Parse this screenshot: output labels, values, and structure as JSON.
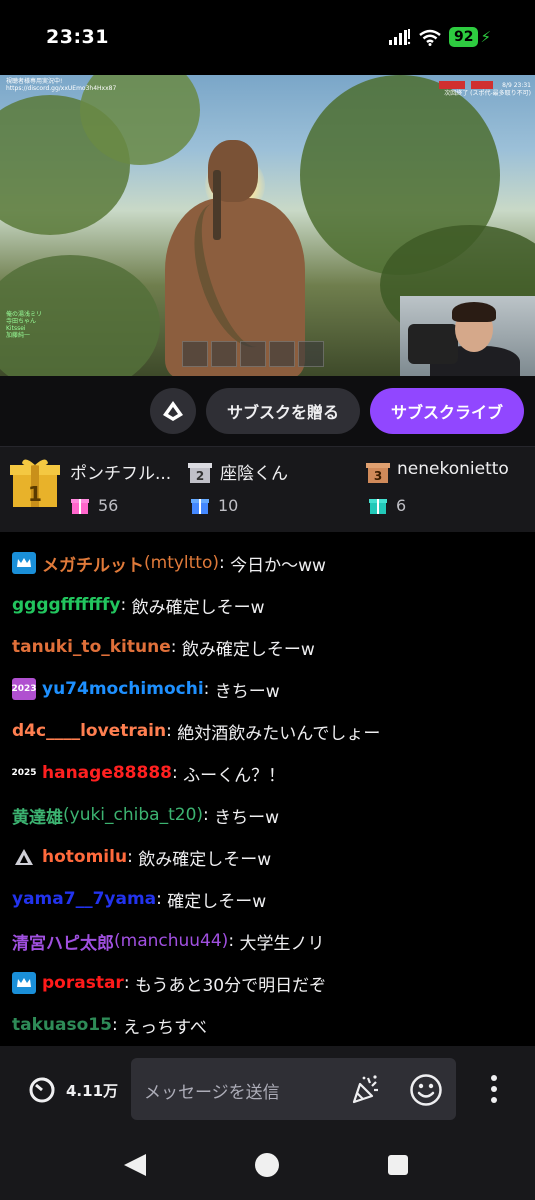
{
  "status_bar": {
    "time": "23:31",
    "battery": "92"
  },
  "video": {
    "overlay_top_left": "視聴者様専用実況中!",
    "overlay_top_left_url": "https://discord.gg/xxUEmo3h4Hxx87",
    "overlay_top_right": "8/9 23:31",
    "overlay_top_right_sub": "次回終了 (スポ代-最多取り不可)",
    "overlay_list": [
      "俺の湯浅ミリ",
      "寺田ちゃん",
      "Kitssei",
      "加藤純一"
    ]
  },
  "actions": {
    "gift_sub_label": "サブスクを贈る",
    "sub_live_label": "サブスクライブ"
  },
  "leaderboard": [
    {
      "rank": "1",
      "name": "ポンチフル...",
      "count": "56"
    },
    {
      "rank": "2",
      "name": "座陰くん",
      "count": "10"
    },
    {
      "rank": "3",
      "name": "nenekonietto",
      "count": "6"
    }
  ],
  "chat": [
    {
      "badge": "crown",
      "user": "メガチルット",
      "login": " (mtyltto)",
      "text": "今日か〜ww",
      "color": "#e07a3a"
    },
    {
      "badge": "",
      "user": "ggggfffffffy",
      "login": "",
      "text": "飲み確定しそーw",
      "color": "#22c55e"
    },
    {
      "badge": "",
      "user": "tanuki_to_kitune",
      "login": "",
      "text": "飲み確定しそーw",
      "color": "#e0703a"
    },
    {
      "badge": "2023",
      "user": "yu74mochimochi",
      "login": "",
      "text": "きちーw",
      "color": "#1e90ff"
    },
    {
      "badge": "",
      "user": "d4c____lovetrain",
      "login": "",
      "text": "絶対酒飲みたいんでしょー",
      "color": "#ff7f50"
    },
    {
      "badge": "2025",
      "user": "hanage88888",
      "login": "",
      "text": "ふーくん？！",
      "color": "#ff2020"
    },
    {
      "badge": "",
      "user": "黄達雄",
      "login": " (yuki_chiba_t20)",
      "text": "きちーw",
      "color": "#3cb371"
    },
    {
      "badge": "prime",
      "user": "hotomilu",
      "login": "",
      "text": "飲み確定しそーw",
      "color": "#ff6a3c"
    },
    {
      "badge": "",
      "user": "yama7__7yama",
      "login": "",
      "text": "確定しそーw",
      "color": "#2233ee"
    },
    {
      "badge": "",
      "user": "清宮ハピ太郎",
      "login": " (manchuu44)",
      "text": "大学生ノリ",
      "color": "#a050e0"
    },
    {
      "badge": "crown",
      "user": "porastar",
      "login": "",
      "text": "もうあと30分で明日だぞ",
      "color": "#ff1a1a"
    },
    {
      "badge": "",
      "user": "takuaso15",
      "login": "",
      "text": "えっちすべ",
      "color": "#2e8b57"
    }
  ],
  "input_bar": {
    "viewer_count": "4.11万",
    "placeholder": "メッセージを送信"
  },
  "colors": {
    "accent": "#9147ff",
    "battery": "#2ecc40",
    "panel": "#18181b",
    "button": "#2f2f35"
  }
}
